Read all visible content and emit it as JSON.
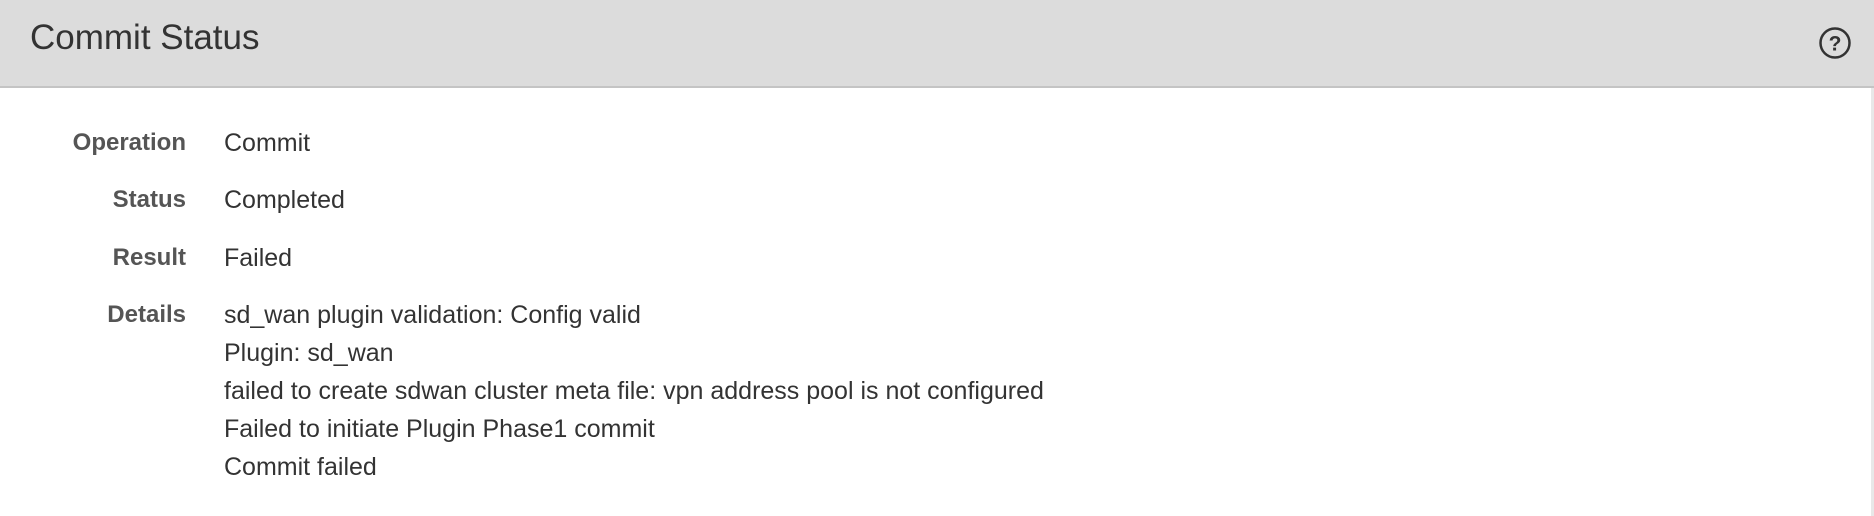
{
  "dialog": {
    "title": "Commit Status",
    "help_icon": "question-circle-icon"
  },
  "fields": {
    "operation": {
      "label": "Operation",
      "value": "Commit"
    },
    "status": {
      "label": "Status",
      "value": "Completed"
    },
    "result": {
      "label": "Result",
      "value": "Failed"
    },
    "details": {
      "label": "Details",
      "lines": [
        "sd_wan plugin validation: Config valid",
        "Plugin: sd_wan",
        "failed to create sdwan cluster meta file: vpn address pool is not configured",
        "Failed to initiate Plugin Phase1 commit",
        "Commit failed"
      ]
    }
  }
}
